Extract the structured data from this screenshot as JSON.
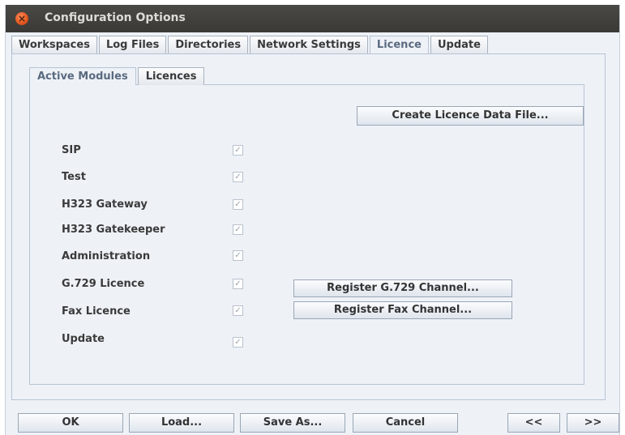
{
  "window": {
    "title": "Configuration Options",
    "close_glyph": "×"
  },
  "tabs": [
    {
      "label": "Workspaces",
      "active": false
    },
    {
      "label": "Log Files",
      "active": false
    },
    {
      "label": "Directories",
      "active": false
    },
    {
      "label": "Network Settings",
      "active": false
    },
    {
      "label": "Licence",
      "active": true
    },
    {
      "label": "Update",
      "active": false
    }
  ],
  "subtabs": [
    {
      "label": "Active Modules",
      "active": true
    },
    {
      "label": "Licences",
      "active": false
    }
  ],
  "create_button": "Create Licence Data File...",
  "modules": [
    {
      "label": "SIP",
      "checked": true
    },
    {
      "label": "Test",
      "checked": true
    },
    {
      "label": "H323 Gateway",
      "checked": true
    },
    {
      "label": "H323 Gatekeeper",
      "checked": true
    },
    {
      "label": "Administration",
      "checked": true
    },
    {
      "label": "G.729 Licence",
      "checked": true
    },
    {
      "label": "Fax Licence",
      "checked": true
    },
    {
      "label": "Update",
      "checked": true
    }
  ],
  "register_g729_button": "Register G.729 Channel...",
  "register_fax_button": "Register Fax Channel...",
  "bottom": {
    "ok": "OK",
    "load": "Load...",
    "save_as": "Save As...",
    "cancel": "Cancel",
    "prev": "<<",
    "next": ">>"
  },
  "check_glyph": "✓"
}
